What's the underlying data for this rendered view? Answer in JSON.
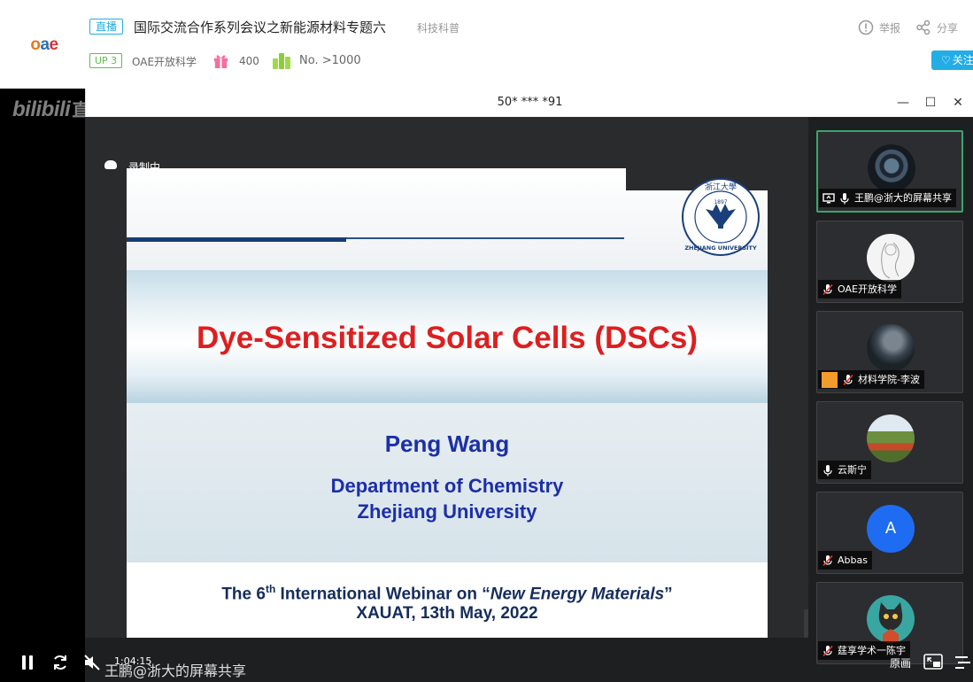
{
  "header": {
    "logo_text_o": "o",
    "logo_text_a": "a",
    "logo_text_e": "e",
    "live_tag": "直播",
    "title": "国际交流合作系列会议之新能源材料专题六",
    "category": "科技科普",
    "up_level": "UP 3",
    "up_name": "OAE开放科学",
    "gift_count": "400",
    "rank": "No. >1000",
    "report_label": "举报",
    "share_label": "分享",
    "follow_label": "关注"
  },
  "player": {
    "watermark": "bilibili",
    "watermark_suffix": "直播",
    "time": "1:04:15",
    "danmaku": "王鹏@浙大的屏幕共享",
    "quality_label": "原画"
  },
  "meeting": {
    "window_title": "50* *** *91",
    "recording_label": "录制中"
  },
  "slide": {
    "title": "Dye-Sensitized Solar Cells (DSCs)",
    "author": "Peng Wang",
    "department": "Department of Chemistry",
    "university": "Zhejiang University",
    "webinar_prefix": "The 6",
    "webinar_sup": "th",
    "webinar_mid": " International Webinar on “",
    "webinar_italic": "New Energy Materials",
    "webinar_suffix": "”",
    "venue": "XAUAT, 13th May, 2022",
    "seal_year": "1897",
    "seal_name": "ZHEJIANG UNIVERSITY",
    "seal_chars": "浙江大學"
  },
  "participants": [
    {
      "name": "王鹏@浙大的屏幕共享",
      "mic": "on",
      "sharing": true
    },
    {
      "name": "OAE开放科学",
      "mic": "muted"
    },
    {
      "name": "材料学院-李波",
      "mic": "muted",
      "badge": true
    },
    {
      "name": "云斯宁",
      "mic": "on"
    },
    {
      "name": "Abbas",
      "mic": "muted",
      "initial": "A"
    },
    {
      "name": "莛享学术一陈宇",
      "mic": "muted"
    }
  ],
  "colors": {
    "accent": "#23ade5",
    "up_green": "#5dbf45",
    "slide_title_red": "#dd1f20",
    "slide_blue": "#1c2fa8",
    "active_tile": "#3aa56b"
  }
}
